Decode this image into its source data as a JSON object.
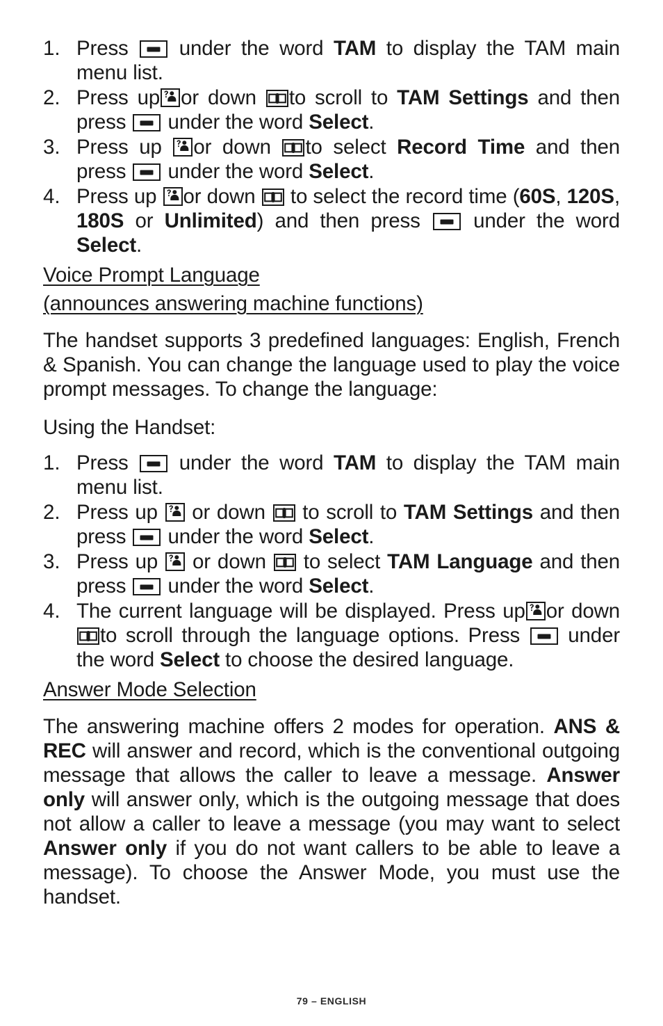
{
  "page": {
    "footer": "79 – ENGLISH"
  },
  "icons": {
    "softkey": "softkey-dash-icon",
    "up": "caller-id-person-question-icon",
    "down": "phonebook-open-book-icon"
  },
  "record_time_steps": {
    "items": [
      {
        "num": "1.",
        "parts": [
          {
            "t": "text",
            "v": "Press "
          },
          {
            "t": "key",
            "v": "softkey"
          },
          {
            "t": "text",
            "v": " under the word "
          },
          {
            "t": "bold",
            "v": "TAM"
          },
          {
            "t": "text",
            "v": " to display the TAM main menu list."
          }
        ]
      },
      {
        "num": "2.",
        "parts": [
          {
            "t": "text",
            "v": "Press up"
          },
          {
            "t": "key",
            "v": "up"
          },
          {
            "t": "text",
            "v": "or down "
          },
          {
            "t": "key",
            "v": "down"
          },
          {
            "t": "text",
            "v": "to scroll to "
          },
          {
            "t": "bold",
            "v": "TAM Settings"
          },
          {
            "t": "text",
            "v": " and then press "
          },
          {
            "t": "key",
            "v": "softkey"
          },
          {
            "t": "text",
            "v": " under the word "
          },
          {
            "t": "bold",
            "v": "Select"
          },
          {
            "t": "text",
            "v": "."
          }
        ]
      },
      {
        "num": "3.",
        "parts": [
          {
            "t": "text",
            "v": "Press up "
          },
          {
            "t": "key",
            "v": "up"
          },
          {
            "t": "text",
            "v": "or down "
          },
          {
            "t": "key",
            "v": "down"
          },
          {
            "t": "text",
            "v": "to select "
          },
          {
            "t": "bold",
            "v": "Record Time"
          },
          {
            "t": "text",
            "v": " and then press "
          },
          {
            "t": "key",
            "v": "softkey"
          },
          {
            "t": "text",
            "v": " under the word "
          },
          {
            "t": "bold",
            "v": "Select"
          },
          {
            "t": "text",
            "v": "."
          }
        ]
      },
      {
        "num": "4.",
        "parts": [
          {
            "t": "text",
            "v": "Press up "
          },
          {
            "t": "key",
            "v": "up"
          },
          {
            "t": "text",
            "v": "or down "
          },
          {
            "t": "key",
            "v": "down"
          },
          {
            "t": "text",
            "v": " to select the record time ("
          },
          {
            "t": "bold",
            "v": "60S"
          },
          {
            "t": "text",
            "v": ", "
          },
          {
            "t": "bold",
            "v": "120S"
          },
          {
            "t": "text",
            "v": ", "
          },
          {
            "t": "bold",
            "v": "180S"
          },
          {
            "t": "text",
            "v": " or "
          },
          {
            "t": "bold",
            "v": "Unlimited"
          },
          {
            "t": "text",
            "v": ") and then press "
          },
          {
            "t": "key",
            "v": "softkey"
          },
          {
            "t": "text",
            "v": " under the word "
          },
          {
            "t": "bold",
            "v": "Select"
          },
          {
            "t": "text",
            "v": "."
          }
        ]
      }
    ]
  },
  "voice_prompt_section": {
    "heading_line_1": "Voice Prompt Language",
    "heading_line_2": "(announces answering machine functions)",
    "intro": "The handset supports 3 predefined languages: English, French & Spanish.  You can change the language used to play the voice prompt messages.  To change the language:",
    "subhead": "Using the Handset:",
    "steps": [
      {
        "num": "1.",
        "parts": [
          {
            "t": "text",
            "v": "Press "
          },
          {
            "t": "key",
            "v": "softkey"
          },
          {
            "t": "text",
            "v": " under the word "
          },
          {
            "t": "bold",
            "v": "TAM"
          },
          {
            "t": "text",
            "v": " to display the TAM main menu list."
          }
        ]
      },
      {
        "num": "2.",
        "parts": [
          {
            "t": "text",
            "v": "Press up "
          },
          {
            "t": "key",
            "v": "up"
          },
          {
            "t": "text",
            "v": " or down "
          },
          {
            "t": "key",
            "v": "down"
          },
          {
            "t": "text",
            "v": " to scroll to "
          },
          {
            "t": "bold",
            "v": "TAM Settings"
          },
          {
            "t": "text",
            "v": " and then press "
          },
          {
            "t": "key",
            "v": "softkey"
          },
          {
            "t": "text",
            "v": " under the word "
          },
          {
            "t": "bold",
            "v": "Select"
          },
          {
            "t": "text",
            "v": "."
          }
        ]
      },
      {
        "num": "3.",
        "parts": [
          {
            "t": "text",
            "v": "Press up "
          },
          {
            "t": "key",
            "v": "up"
          },
          {
            "t": "text",
            "v": " or down "
          },
          {
            "t": "key",
            "v": "down"
          },
          {
            "t": "text",
            "v": " to select "
          },
          {
            "t": "bold",
            "v": "TAM Language"
          },
          {
            "t": "text",
            "v": " and then press "
          },
          {
            "t": "key",
            "v": "softkey"
          },
          {
            "t": "text",
            "v": " under the word "
          },
          {
            "t": "bold",
            "v": "Select"
          },
          {
            "t": "text",
            "v": "."
          }
        ]
      },
      {
        "num": "4.",
        "parts": [
          {
            "t": "text",
            "v": "The current language will be displayed. Press up"
          },
          {
            "t": "key",
            "v": "up"
          },
          {
            "t": "text",
            "v": "or down"
          },
          {
            "t": "key",
            "v": "down"
          },
          {
            "t": "text",
            "v": "to scroll through the language options. Press "
          },
          {
            "t": "key",
            "v": "softkey"
          },
          {
            "t": "text",
            "v": " under the word "
          },
          {
            "t": "bold",
            "v": "Select"
          },
          {
            "t": "text",
            "v": " to choose the desired language."
          }
        ]
      }
    ]
  },
  "answer_mode_section": {
    "heading": "Answer Mode Selection",
    "body_parts": [
      {
        "t": "text",
        "v": "The answering machine offers 2 modes for operation. "
      },
      {
        "t": "bold",
        "v": "ANS & REC"
      },
      {
        "t": "text",
        "v": " will answer and record, which is the conventional outgoing message that allows the caller to leave a message. "
      },
      {
        "t": "bold",
        "v": "Answer only"
      },
      {
        "t": "text",
        "v": " will answer only, which is the outgoing message that does not allow a caller to leave a message (you may want to select "
      },
      {
        "t": "bold",
        "v": "Answer only"
      },
      {
        "t": "text",
        "v": " if you do not want callers to be able to leave a message).  To choose the Answer Mode, you must use the handset."
      }
    ]
  }
}
